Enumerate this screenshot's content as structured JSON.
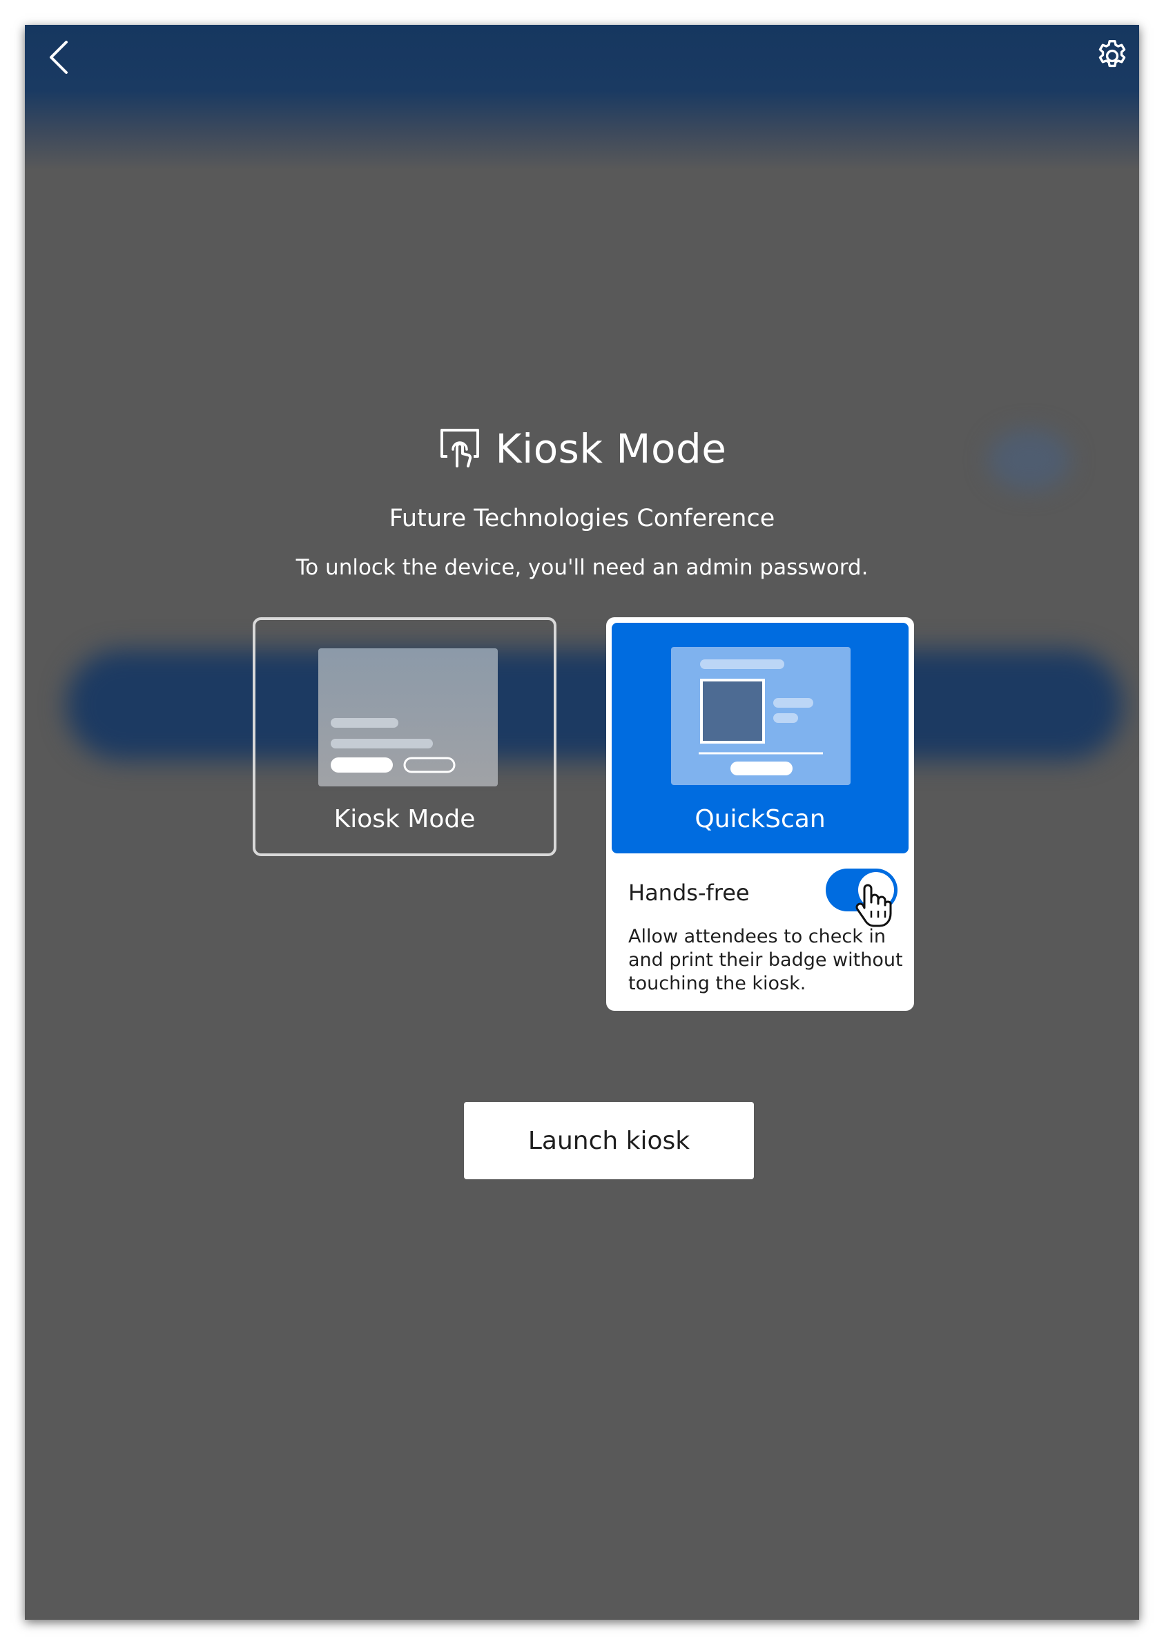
{
  "header": {
    "title": "Kiosk Mode",
    "icon": "touch-screen-icon"
  },
  "event": {
    "name": "Future Technologies Conference"
  },
  "hint": "To unlock the device, you'll need an admin password.",
  "modes": {
    "kiosk": {
      "label": "Kiosk Mode",
      "selected": false
    },
    "quickscan": {
      "label": "QuickScan",
      "selected": true
    }
  },
  "handsfree": {
    "label": "Hands-free",
    "description": "Allow attendees to check in and print their badge without touching the kiosk.",
    "enabled": true
  },
  "actions": {
    "launch_label": "Launch kiosk"
  },
  "colors": {
    "accent": "#006ce0",
    "topbar": "#163760",
    "overlay": "#595959",
    "card_text": "#1f1f1f"
  }
}
